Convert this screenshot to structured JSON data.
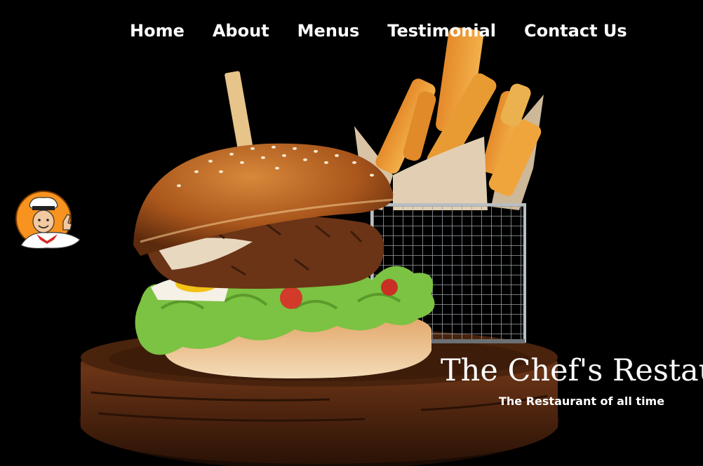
{
  "nav": {
    "items": [
      {
        "label": "Home"
      },
      {
        "label": "About"
      },
      {
        "label": "Menus"
      },
      {
        "label": "Testimonial"
      },
      {
        "label": "Contact Us"
      }
    ]
  },
  "hero": {
    "title": "The Chef's Restau",
    "subtitle": "The Restaurant of all time",
    "image": "burger-and-fries-photo"
  },
  "logo": {
    "icon": "chef-mascot-icon"
  },
  "colors": {
    "background": "#000000",
    "text": "#ffffff",
    "logo_orange": "#f7931e",
    "board_brown": "#5a2d14",
    "bun_brown": "#b5651d",
    "lettuce_green": "#7cc243"
  }
}
